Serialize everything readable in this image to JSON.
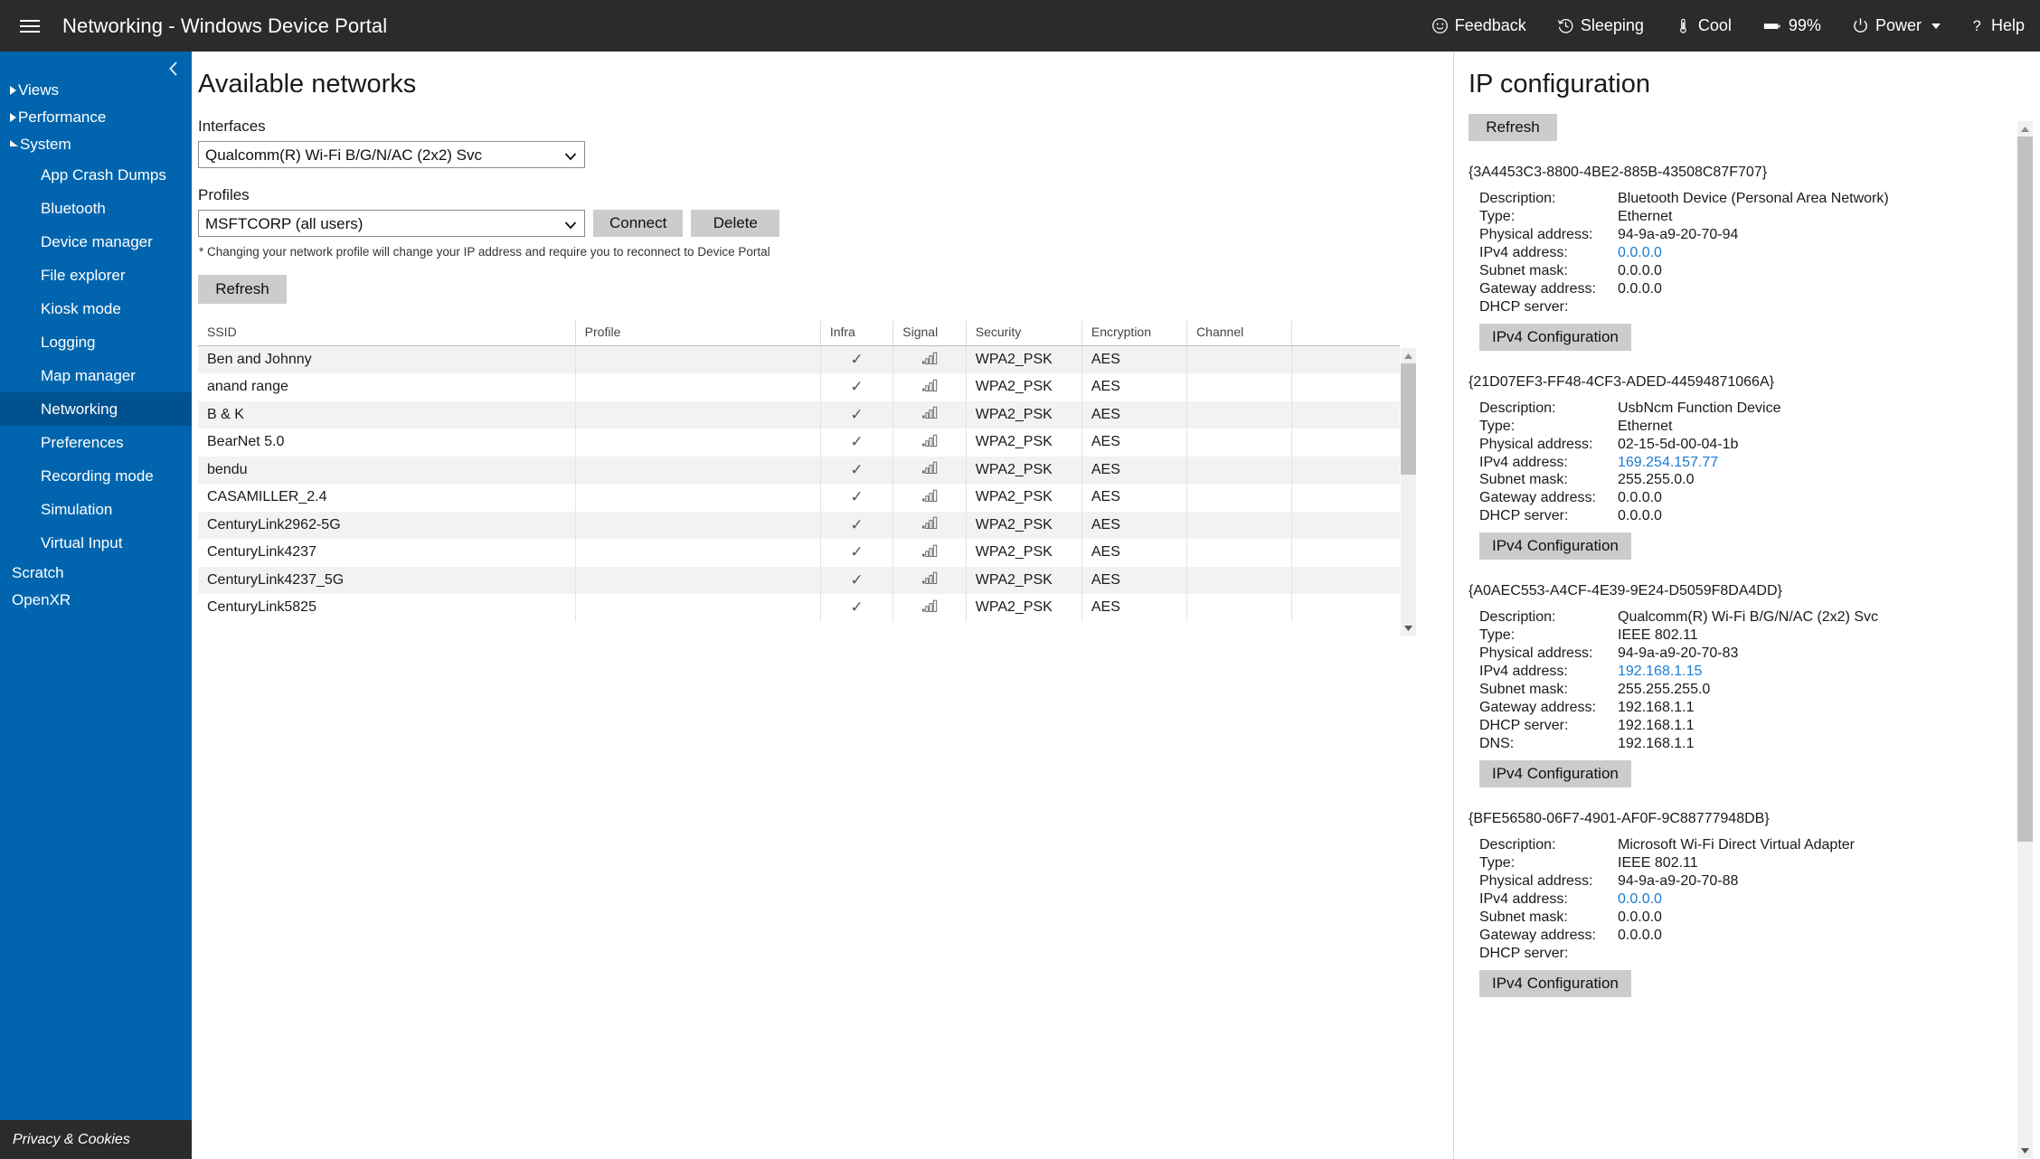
{
  "topbar": {
    "app_title": "Networking - Windows Device Portal",
    "menu_icon": "hamburger-icon",
    "items": [
      {
        "label": "Feedback",
        "icon": "smiley-icon"
      },
      {
        "label": "Sleeping",
        "icon": "clock-icon"
      },
      {
        "label": "Cool",
        "icon": "thermometer-icon"
      },
      {
        "label": "99%",
        "icon": "battery-icon"
      },
      {
        "label": "Power",
        "icon": "power-icon",
        "has_caret": true
      },
      {
        "label": "Help",
        "icon": "question-icon"
      }
    ]
  },
  "sidebar": {
    "collapse_icon": "chevron-left-icon",
    "groups": [
      {
        "label": "Views",
        "expanded": false
      },
      {
        "label": "Performance",
        "expanded": false
      },
      {
        "label": "System",
        "expanded": true
      }
    ],
    "system_items": [
      "App Crash Dumps",
      "Bluetooth",
      "Device manager",
      "File explorer",
      "Kiosk mode",
      "Logging",
      "Map manager",
      "Networking",
      "Preferences",
      "Recording mode",
      "Simulation",
      "Virtual Input"
    ],
    "active_item": "Networking",
    "top_items": [
      "Scratch",
      "OpenXR"
    ],
    "privacy_label": "Privacy & Cookies",
    "accent_color": "#0065ae",
    "active_color": "#00528f"
  },
  "main": {
    "title": "Available networks",
    "interfaces_label": "Interfaces",
    "interfaces_value": "Qualcomm(R) Wi-Fi B/G/N/AC (2x2) Svc",
    "profiles_label": "Profiles",
    "profiles_value": "MSFTCORP (all users)",
    "connect_label": "Connect",
    "delete_label": "Delete",
    "note": "* Changing your network profile will change your IP address and require you to reconnect to Device Portal",
    "refresh_label": "Refresh",
    "columns": [
      "SSID",
      "Profile",
      "Infra",
      "Signal",
      "Security",
      "Encryption",
      "Channel"
    ],
    "rows": [
      {
        "ssid": "Ben and Johnny",
        "profile": "",
        "infra": "✓",
        "signal": "signal-icon",
        "security": "WPA2_PSK",
        "encryption": "AES",
        "channel": ""
      },
      {
        "ssid": "anand range",
        "profile": "",
        "infra": "✓",
        "signal": "signal-icon",
        "security": "WPA2_PSK",
        "encryption": "AES",
        "channel": ""
      },
      {
        "ssid": "B & K",
        "profile": "",
        "infra": "✓",
        "signal": "signal-icon",
        "security": "WPA2_PSK",
        "encryption": "AES",
        "channel": ""
      },
      {
        "ssid": "BearNet 5.0",
        "profile": "",
        "infra": "✓",
        "signal": "signal-icon",
        "security": "WPA2_PSK",
        "encryption": "AES",
        "channel": ""
      },
      {
        "ssid": "bendu",
        "profile": "",
        "infra": "✓",
        "signal": "signal-icon",
        "security": "WPA2_PSK",
        "encryption": "AES",
        "channel": ""
      },
      {
        "ssid": "CASAMILLER_2.4",
        "profile": "",
        "infra": "✓",
        "signal": "signal-icon",
        "security": "WPA2_PSK",
        "encryption": "AES",
        "channel": ""
      },
      {
        "ssid": "CenturyLink2962-5G",
        "profile": "",
        "infra": "✓",
        "signal": "signal-icon",
        "security": "WPA2_PSK",
        "encryption": "AES",
        "channel": ""
      },
      {
        "ssid": "CenturyLink4237",
        "profile": "",
        "infra": "✓",
        "signal": "signal-icon",
        "security": "WPA2_PSK",
        "encryption": "AES",
        "channel": ""
      },
      {
        "ssid": "CenturyLink4237_5G",
        "profile": "",
        "infra": "✓",
        "signal": "signal-icon",
        "security": "WPA2_PSK",
        "encryption": "AES",
        "channel": ""
      },
      {
        "ssid": "CenturyLink5825",
        "profile": "",
        "infra": "✓",
        "signal": "signal-icon",
        "security": "WPA2_PSK",
        "encryption": "AES",
        "channel": ""
      }
    ]
  },
  "right": {
    "title": "IP configuration",
    "refresh_label": "Refresh",
    "ipv4_config_label": "IPv4 Configuration",
    "link_color": "#1a7bd4",
    "adapters": [
      {
        "guid": "{3A4453C3-8800-4BE2-885B-43508C87F707}",
        "fields": [
          {
            "key": "Description:",
            "value": "Bluetooth Device (Personal Area Network)",
            "link": false
          },
          {
            "key": "Type:",
            "value": "Ethernet",
            "link": false
          },
          {
            "key": "Physical address:",
            "value": "94-9a-a9-20-70-94",
            "link": false
          },
          {
            "key": "IPv4 address:",
            "value": "0.0.0.0",
            "link": true
          },
          {
            "key": "Subnet mask:",
            "value": "0.0.0.0",
            "link": false
          },
          {
            "key": "Gateway address:",
            "value": "0.0.0.0",
            "link": false
          },
          {
            "key": "DHCP server:",
            "value": "",
            "link": false
          }
        ]
      },
      {
        "guid": "{21D07EF3-FF48-4CF3-ADED-44594871066A}",
        "fields": [
          {
            "key": "Description:",
            "value": "UsbNcm Function Device",
            "link": false
          },
          {
            "key": "Type:",
            "value": "Ethernet",
            "link": false
          },
          {
            "key": "Physical address:",
            "value": "02-15-5d-00-04-1b",
            "link": false
          },
          {
            "key": "IPv4 address:",
            "value": "169.254.157.77",
            "link": true
          },
          {
            "key": "Subnet mask:",
            "value": "255.255.0.0",
            "link": false
          },
          {
            "key": "Gateway address:",
            "value": "0.0.0.0",
            "link": false
          },
          {
            "key": "DHCP server:",
            "value": "0.0.0.0",
            "link": false
          }
        ]
      },
      {
        "guid": "{A0AEC553-A4CF-4E39-9E24-D5059F8DA4DD}",
        "fields": [
          {
            "key": "Description:",
            "value": "Qualcomm(R) Wi-Fi B/G/N/AC (2x2) Svc",
            "link": false
          },
          {
            "key": "Type:",
            "value": "IEEE 802.11",
            "link": false
          },
          {
            "key": "Physical address:",
            "value": "94-9a-a9-20-70-83",
            "link": false
          },
          {
            "key": "IPv4 address:",
            "value": "192.168.1.15",
            "link": true
          },
          {
            "key": "Subnet mask:",
            "value": "255.255.255.0",
            "link": false
          },
          {
            "key": "Gateway address:",
            "value": "192.168.1.1",
            "link": false
          },
          {
            "key": "DHCP server:",
            "value": "192.168.1.1",
            "link": false
          },
          {
            "key": "DNS:",
            "value": "192.168.1.1",
            "link": false
          }
        ]
      },
      {
        "guid": "{BFE56580-06F7-4901-AF0F-9C88777948DB}",
        "fields": [
          {
            "key": "Description:",
            "value": "Microsoft Wi-Fi Direct Virtual Adapter",
            "link": false
          },
          {
            "key": "Type:",
            "value": "IEEE 802.11",
            "link": false
          },
          {
            "key": "Physical address:",
            "value": "94-9a-a9-20-70-88",
            "link": false
          },
          {
            "key": "IPv4 address:",
            "value": "0.0.0.0",
            "link": true
          },
          {
            "key": "Subnet mask:",
            "value": "0.0.0.0",
            "link": false
          },
          {
            "key": "Gateway address:",
            "value": "0.0.0.0",
            "link": false
          },
          {
            "key": "DHCP server:",
            "value": "",
            "link": false
          }
        ]
      }
    ]
  }
}
